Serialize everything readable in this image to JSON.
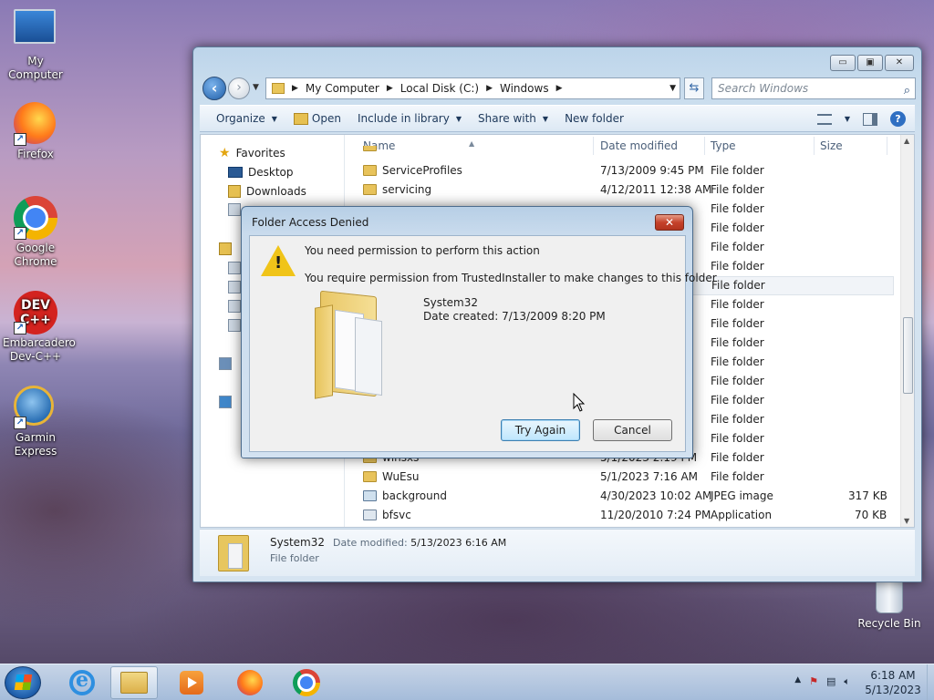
{
  "desktop": {
    "icons": [
      {
        "label": "My Computer",
        "icon": "computer-icon"
      },
      {
        "label": "Firefox",
        "icon": "firefox-icon"
      },
      {
        "label": "Google Chrome",
        "icon": "chrome-icon"
      },
      {
        "label": "Embarcadero Dev-C++",
        "icon": "devcpp-icon",
        "badge": "DEV C++"
      },
      {
        "label": "Garmin Express",
        "icon": "garmin-icon"
      }
    ],
    "recycle_bin": "Recycle Bin"
  },
  "explorer": {
    "controls": {
      "minimize": "▭",
      "maximize": "▣",
      "close": "✕"
    },
    "breadcrumbs": [
      "My Computer",
      "Local Disk (C:)",
      "Windows"
    ],
    "search_placeholder": "Search Windows",
    "toolbar": {
      "organize": "Organize",
      "open": "Open",
      "include": "Include in library",
      "share": "Share with",
      "new_folder": "New folder"
    },
    "nav": {
      "favorites": "Favorites",
      "desktop": "Desktop",
      "downloads": "Downloads"
    },
    "columns": {
      "name": "Name",
      "date": "Date modified",
      "type": "Type",
      "size": "Size"
    },
    "rows": [
      {
        "name": "ServiceProfiles",
        "date": "7/13/2009 9:45 PM",
        "type": "File folder",
        "size": "",
        "kind": "folder"
      },
      {
        "name": "servicing",
        "date": "4/12/2011 12:38 AM",
        "type": "File folder",
        "size": "",
        "kind": "folder"
      }
    ],
    "hidden_rows_types": [
      "File folder",
      "File folder",
      "File folder",
      "File folder",
      "File folder",
      "File folder",
      "File folder",
      "File folder",
      "File folder",
      "File folder",
      "File folder",
      "File folder",
      "File folder",
      "File folder"
    ],
    "bottom_rows": [
      {
        "name": "winsxs",
        "date": "5/1/2023 2:19 PM",
        "type": "File folder",
        "size": "",
        "kind": "folder"
      },
      {
        "name": "WuEsu",
        "date": "5/1/2023 7:16 AM",
        "type": "File folder",
        "size": "",
        "kind": "folder"
      },
      {
        "name": "background",
        "date": "4/30/2023 10:02 AM",
        "type": "JPEG image",
        "size": "317 KB",
        "kind": "img"
      },
      {
        "name": "bfsvc",
        "date": "11/20/2010 7:24 PM",
        "type": "Application",
        "size": "70 KB",
        "kind": "app"
      }
    ],
    "details": {
      "name": "System32",
      "modified_label": "Date modified:",
      "modified_value": "5/13/2023 6:16 AM",
      "type": "File folder"
    }
  },
  "dialog": {
    "title": "Folder Access Denied",
    "close": "✕",
    "message1": "You need permission to perform this action",
    "message2": "You require permission from TrustedInstaller to make changes to this folder",
    "folder_name": "System32",
    "date_created": "Date created: 7/13/2009 8:20 PM",
    "try_again": "Try Again",
    "cancel": "Cancel"
  },
  "taskbar": {
    "apps": [
      "internet-explorer",
      "windows-explorer",
      "windows-media-player",
      "firefox",
      "chrome"
    ],
    "time": "6:18 AM",
    "date": "5/13/2023",
    "tray_arrow": "▲"
  }
}
